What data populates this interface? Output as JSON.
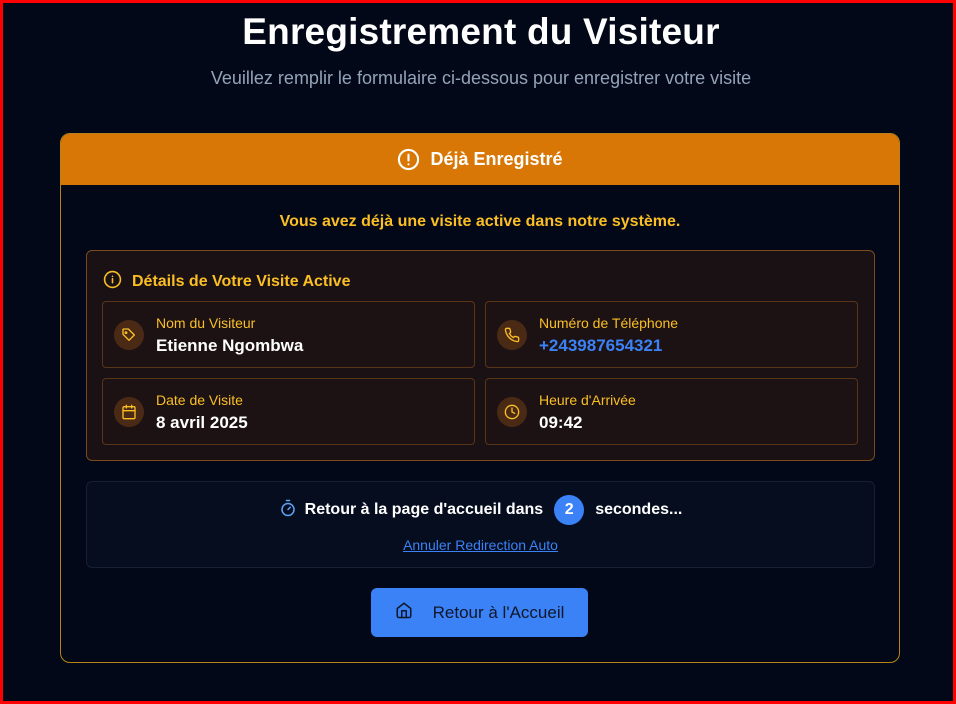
{
  "page": {
    "title": "Enregistrement du Visiteur",
    "subtitle": "Veuillez remplir le formulaire ci-dessous pour enregistrer votre visite"
  },
  "card": {
    "header": "Déjà Enregistré",
    "message": "Vous avez déjà une visite active dans notre système."
  },
  "details": {
    "title": "Détails de Votre Visite Active",
    "fields": [
      {
        "label": "Nom du Visiteur",
        "value": "Etienne Ngombwa",
        "icon": "tag-icon"
      },
      {
        "label": "Numéro de Téléphone",
        "value": "+243987654321",
        "icon": "phone-icon"
      },
      {
        "label": "Date de Visite",
        "value": "8 avril 2025",
        "icon": "calendar-icon"
      },
      {
        "label": "Heure d'Arrivée",
        "value": "09:42",
        "icon": "clock-icon"
      }
    ]
  },
  "redirect": {
    "text_before": "Retour à la page d'accueil dans",
    "seconds": "2",
    "text_after": "secondes...",
    "cancel_label": "Annuler Redirection Auto"
  },
  "home_button": {
    "label": "Retour à l'Accueil"
  },
  "colors": {
    "background": "#020817",
    "accent_orange": "#d97706",
    "accent_amber": "#fbbf24",
    "accent_blue": "#3b82f6"
  }
}
